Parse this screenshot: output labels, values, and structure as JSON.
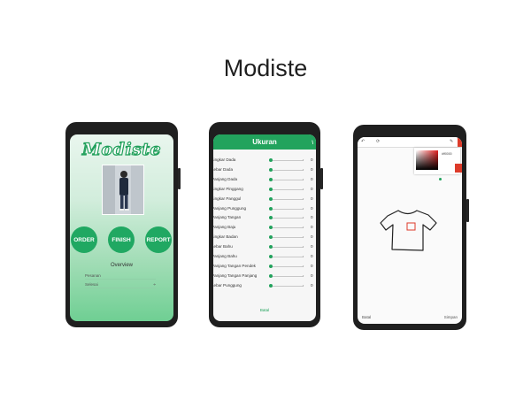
{
  "app_title": "Modiste",
  "screen1": {
    "logo": "Modiste",
    "buttons": [
      "ORDER",
      "FINISH",
      "REPORT"
    ],
    "overview": "Overview",
    "fields": [
      "Pesanan",
      "Selesai"
    ]
  },
  "screen2": {
    "header": "Ukuran",
    "rows": [
      {
        "label": "Lingkar Dada",
        "value": "0"
      },
      {
        "label": "Lebar Dada",
        "value": "0"
      },
      {
        "label": "Panjang Dada",
        "value": "0"
      },
      {
        "label": "Lingkar Pinggang",
        "value": "0"
      },
      {
        "label": "Lingkar Panggul",
        "value": "0"
      },
      {
        "label": "Panjang Punggung",
        "value": "0"
      },
      {
        "label": "Panjang Tangan",
        "value": "0"
      },
      {
        "label": "Panjang Baju",
        "value": "0"
      },
      {
        "label": "Lingkar Badan",
        "value": "0"
      },
      {
        "label": "Lebar Bahu",
        "value": "0"
      },
      {
        "label": "Panjang Bahu",
        "value": "0"
      },
      {
        "label": "Panjang Tangan Pendek",
        "value": "0"
      },
      {
        "label": "Panjang Tangan Panjang",
        "value": "0"
      },
      {
        "label": "Lebar Punggung",
        "value": "0"
      }
    ],
    "cancel": "Batal"
  },
  "screen3": {
    "hex": "#ff0000",
    "cancel": "Batal",
    "save": "Simpan"
  },
  "colors": {
    "green": "#22a35d",
    "red": "#dd3b2a"
  }
}
